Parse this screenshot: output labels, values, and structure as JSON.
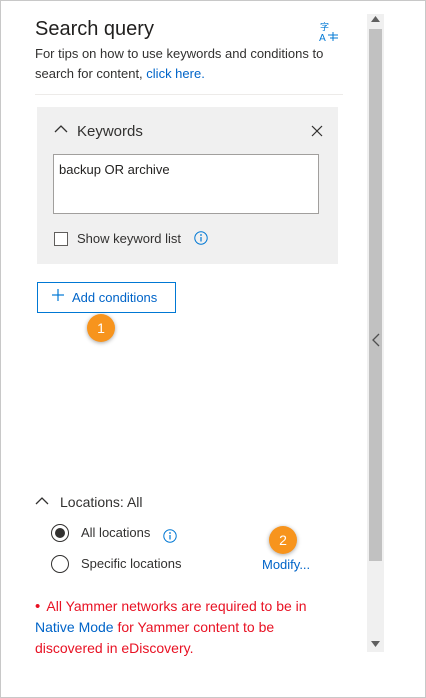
{
  "panel": {
    "title": "Search query",
    "tips_text": "For tips on how to use keywords and conditions to search for content,",
    "tips_link": "click here.",
    "icons": {
      "language": "language-translate-icon",
      "collapse": "chevron-left-icon"
    }
  },
  "keywords": {
    "label": "Keywords",
    "value": "backup OR archive",
    "show_list_label": "Show keyword list",
    "show_list_checked": false
  },
  "conditions": {
    "add_label": "Add conditions",
    "plus_icon": "plus-icon"
  },
  "callouts": {
    "badge_1": "1",
    "badge_2": "2",
    "color": "#f7941d"
  },
  "locations": {
    "label": "Locations: All",
    "options": [
      {
        "label": "All locations",
        "selected": true
      },
      {
        "label": "Specific locations",
        "selected": false
      }
    ],
    "modify_label": "Modify..."
  },
  "warning": {
    "bullet": "•",
    "text_1": "All Yammer networks are required to be in",
    "link": "Native Mode",
    "text_2": "for Yammer content to be discovered in eDiscovery."
  },
  "colors": {
    "link": "#0064c8",
    "accent": "#0078d4",
    "warning": "#e81123",
    "panel_bg": "#f0f0f0"
  }
}
